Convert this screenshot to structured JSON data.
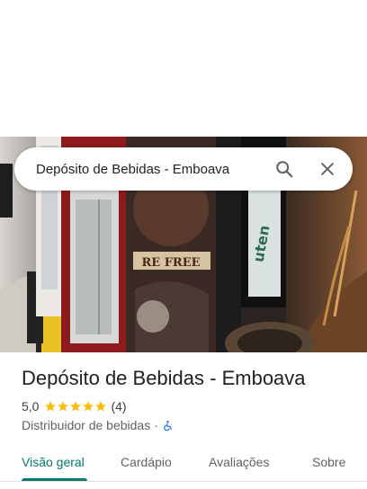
{
  "search": {
    "query": "Depósito de Bebidas - Emboava"
  },
  "photo": {
    "sign_text": "RE FREE",
    "fridge_text": "uten"
  },
  "place": {
    "title": "Depósito de Bebidas - Emboava",
    "rating": "5,0",
    "review_count": "(4)",
    "stars": 5,
    "category": "Distribuidor de bebidas",
    "separator": "·"
  },
  "tabs": [
    {
      "label": "Visão geral",
      "active": true
    },
    {
      "label": "Cardápio",
      "active": false
    },
    {
      "label": "Avaliações",
      "active": false
    },
    {
      "label": "Sobre",
      "active": false
    }
  ],
  "colors": {
    "accent": "#00796b",
    "star": "#fbbc04",
    "accessibility": "#1a73e8"
  },
  "icons": {
    "search": "search-icon",
    "close": "close-icon",
    "star": "star-icon",
    "accessibility": "wheelchair-icon"
  }
}
